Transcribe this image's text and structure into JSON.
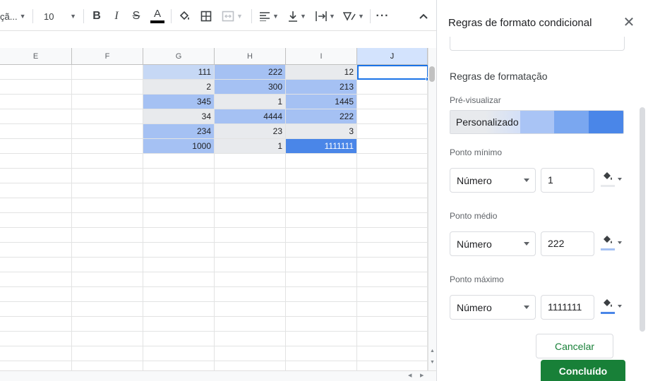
{
  "toolbar": {
    "font_name": "çã...",
    "font_size": "10"
  },
  "grid": {
    "columns": [
      "E",
      "F",
      "G",
      "H",
      "I",
      "J"
    ],
    "selected_column": "J",
    "rows": [
      [
        {
          "v": "111",
          "bg": "#c6d8f5"
        },
        {
          "v": "222",
          "bg": "#a5c1f3"
        },
        {
          "v": "12",
          "bg": "#e8eaed"
        }
      ],
      [
        {
          "v": "2",
          "bg": "#e8eaed"
        },
        {
          "v": "300",
          "bg": "#a5c1f3"
        },
        {
          "v": "213",
          "bg": "#a5c1f3"
        }
      ],
      [
        {
          "v": "345",
          "bg": "#a5c1f3"
        },
        {
          "v": "1",
          "bg": "#e8eaed"
        },
        {
          "v": "1445",
          "bg": "#a5c1f3"
        }
      ],
      [
        {
          "v": "34",
          "bg": "#e8eaed"
        },
        {
          "v": "4444",
          "bg": "#a5c1f3"
        },
        {
          "v": "222",
          "bg": "#a5c1f3"
        }
      ],
      [
        {
          "v": "234",
          "bg": "#a5c1f3"
        },
        {
          "v": "23",
          "bg": "#e8eaed"
        },
        {
          "v": "3",
          "bg": "#e8eaed"
        }
      ],
      [
        {
          "v": "1000",
          "bg": "#a5c1f3"
        },
        {
          "v": "1",
          "bg": "#e8eaed"
        },
        {
          "v": "1111111",
          "bg": "#4a86e8",
          "fg": "#ffffff"
        }
      ]
    ]
  },
  "panel": {
    "title": "Regras de formato condicional",
    "section_title": "Regras de formatação",
    "preview_label": "Pré-visualizar",
    "preview_text": "Personalizado",
    "preview_colors": [
      "#a9c4f5",
      "#7aa7f0",
      "#4a86e8"
    ],
    "min_label": "Ponto mínimo",
    "min_type": "Número",
    "min_value": "1",
    "min_color": "#e8eaed",
    "mid_label": "Ponto médio",
    "mid_type": "Número",
    "mid_value": "222",
    "mid_color": "#a5c1f3",
    "max_label": "Ponto máximo",
    "max_type": "Número",
    "max_value": "1111111",
    "max_color": "#4a86e8",
    "cancel_label": "Cancelar",
    "done_label": "Concluído"
  }
}
